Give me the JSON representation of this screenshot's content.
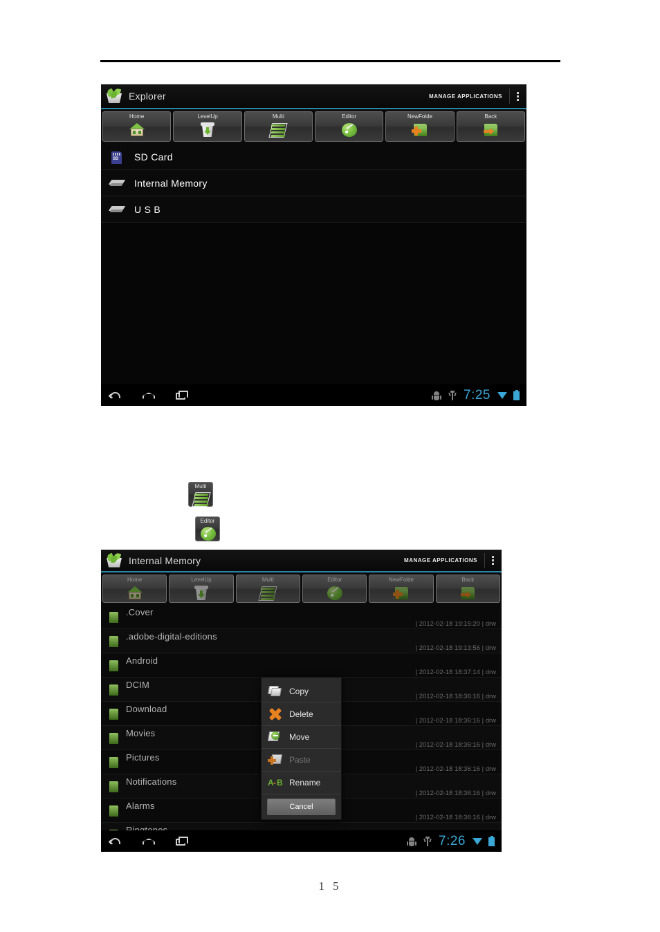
{
  "document": {
    "page_number": "1 5"
  },
  "screenshot_one": {
    "action_bar": {
      "title": "Explorer",
      "manage_label": "MANAGE APPLICATIONS",
      "logo_icon": "explorer-box-icon",
      "overflow_icon": "overflow-menu-icon"
    },
    "toolbar": [
      {
        "label": "Home",
        "icon": "home-icon"
      },
      {
        "label": "LevelUp",
        "icon": "levelup-trash-icon"
      },
      {
        "label": "Multi",
        "icon": "multi-sheets-icon"
      },
      {
        "label": "Editor",
        "icon": "editor-ball-icon"
      },
      {
        "label": "NewFolde",
        "icon": "new-folder-icon"
      },
      {
        "label": "Back",
        "icon": "back-folder-icon"
      }
    ],
    "storage_items": [
      {
        "label": "SD Card",
        "icon": "sd-card-icon",
        "sd_text": "SD"
      },
      {
        "label": "Internal Memory",
        "icon": "hard-disk-icon"
      },
      {
        "label": "U S B",
        "icon": "hard-disk-icon"
      }
    ],
    "nav_bar": {
      "back_icon": "nav-back-icon",
      "home_icon": "nav-home-icon",
      "recents_icon": "nav-recents-icon",
      "android_icon": "android-debug-icon",
      "usb_icon": "usb-icon",
      "clock": "7:25",
      "wifi_icon": "wifi-icon",
      "battery_icon": "battery-icon"
    }
  },
  "inline_figures": [
    {
      "label": "Multi",
      "icon": "multi-sheets-icon"
    },
    {
      "label": "Editor",
      "icon": "editor-ball-icon"
    }
  ],
  "screenshot_two": {
    "action_bar": {
      "title": "Internal Memory",
      "manage_label": "MANAGE APPLICATIONS",
      "logo_icon": "explorer-box-icon",
      "overflow_icon": "overflow-menu-icon"
    },
    "toolbar": [
      {
        "label": "Home",
        "icon": "home-icon"
      },
      {
        "label": "LevelUp",
        "icon": "levelup-trash-icon"
      },
      {
        "label": "Multi",
        "icon": "multi-sheets-icon"
      },
      {
        "label": "Editor",
        "icon": "editor-ball-icon"
      },
      {
        "label": "NewFolde",
        "icon": "new-folder-icon"
      },
      {
        "label": "Back",
        "icon": "back-folder-icon"
      }
    ],
    "files": [
      {
        "name": ".Cover",
        "meta": "| 2012-02-18 19:15:20 | drw"
      },
      {
        "name": ".adobe-digital-editions",
        "meta": "| 2012-02-18 19:13:56 | drw"
      },
      {
        "name": "Android",
        "meta": "| 2012-02-18 18:37:14 | drw"
      },
      {
        "name": "DCIM",
        "meta": "| 2012-02-18 18:36:16 | drw"
      },
      {
        "name": "Download",
        "meta": "| 2012-02-18 18:36:16 | drw"
      },
      {
        "name": "Movies",
        "meta": "| 2012-02-18 18:36:16 | drw"
      },
      {
        "name": "Pictures",
        "meta": "| 2012-02-18 18:36:16 | drw"
      },
      {
        "name": "Notifications",
        "meta": "| 2012-02-18 18:36:16 | drw"
      },
      {
        "name": "Alarms",
        "meta": "| 2012-02-18 18:36:16 | drw"
      },
      {
        "name": "Ringtones",
        "meta": ""
      }
    ],
    "context_menu": {
      "items": [
        {
          "label": "Copy",
          "icon": "copy-icon",
          "disabled": false
        },
        {
          "label": "Delete",
          "icon": "delete-icon",
          "disabled": false
        },
        {
          "label": "Move",
          "icon": "move-icon",
          "disabled": false
        },
        {
          "label": "Paste",
          "icon": "paste-icon",
          "disabled": true
        },
        {
          "label": "Rename",
          "icon": "rename-icon",
          "disabled": false
        }
      ],
      "cancel_label": "Cancel"
    },
    "nav_bar": {
      "back_icon": "nav-back-icon",
      "home_icon": "nav-home-icon",
      "recents_icon": "nav-recents-icon",
      "android_icon": "android-debug-icon",
      "usb_icon": "usb-icon",
      "clock": "7:26",
      "wifi_icon": "wifi-icon",
      "battery_icon": "battery-icon"
    }
  },
  "colors": {
    "accent_blue": "#3aa7d6",
    "accent_green": "#7dc243",
    "accent_orange": "#e8811f",
    "screen_bg": "#0a0a0a"
  }
}
